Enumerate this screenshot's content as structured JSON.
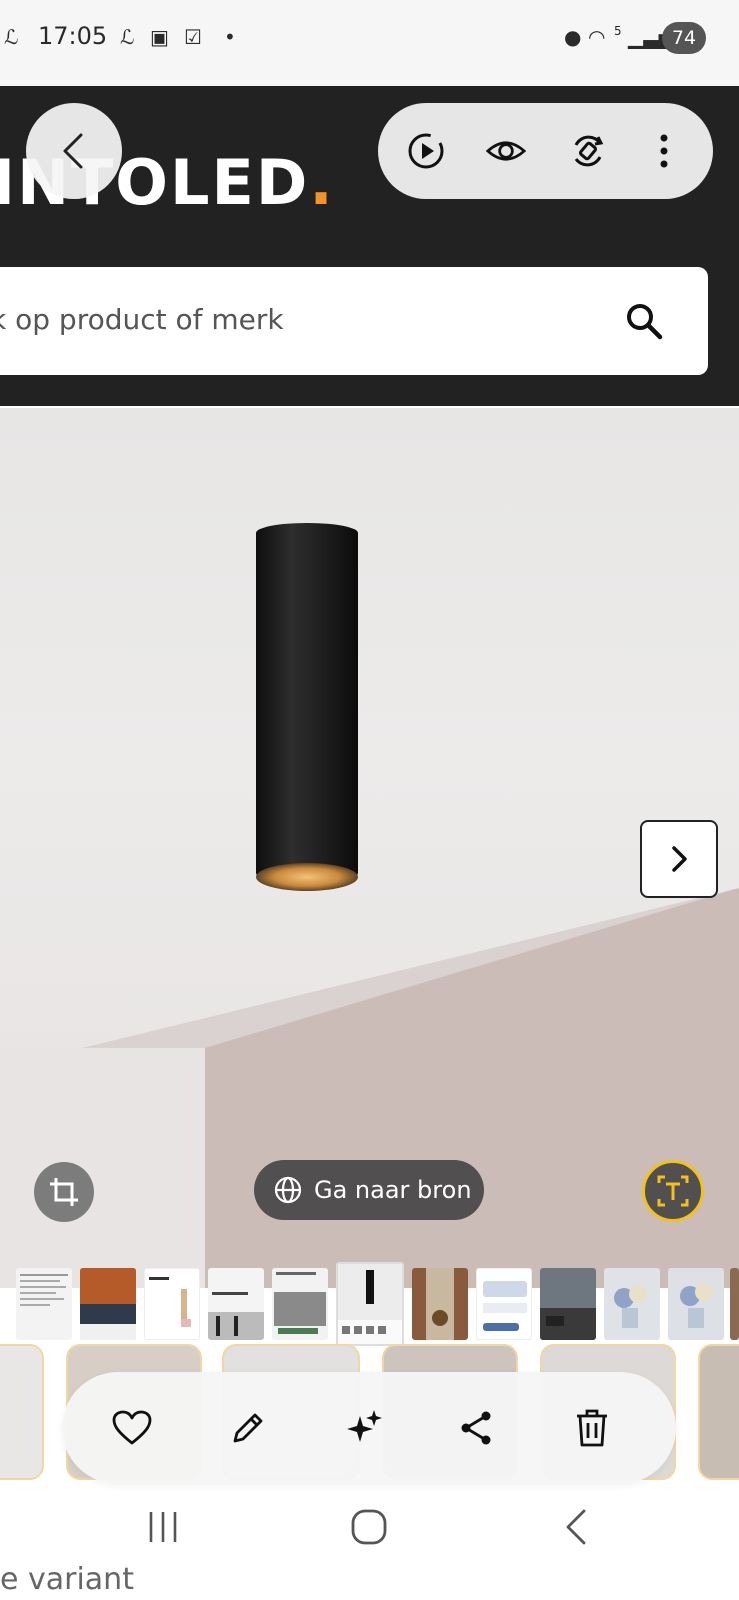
{
  "status_bar": {
    "time": "17:05",
    "battery": "74",
    "network_badge": "5"
  },
  "site": {
    "logo_text": "INTOLED",
    "logo_dot": ".",
    "search_placeholder": "Zoek op product of merk",
    "search_visible_text": "k op product of merk"
  },
  "viewer": {
    "go_to_source_label": "Ga naar bron"
  },
  "footer": {
    "variant_text": "e variant"
  },
  "colors": {
    "header_bg": "#222222",
    "brand_accent": "#f39226",
    "text_extract_ring": "#f2c21b"
  },
  "icons": {
    "toolbar": [
      "play-icon",
      "eye-icon",
      "rotate-icon",
      "more-vertical-icon"
    ],
    "actions": [
      "heart-icon",
      "pencil-icon",
      "sparkles-icon",
      "share-icon",
      "trash-icon"
    ],
    "nav": [
      "recents-icon",
      "home-icon",
      "back-icon"
    ]
  }
}
